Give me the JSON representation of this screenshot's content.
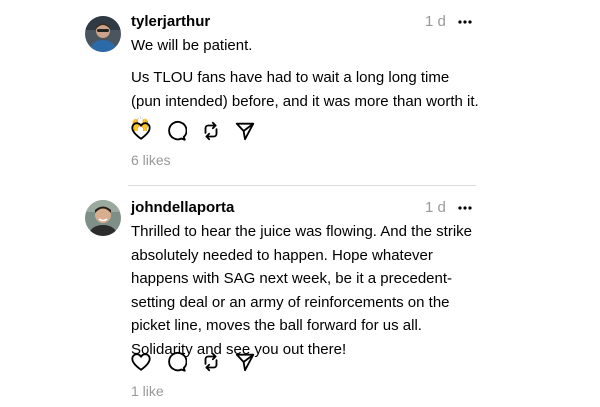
{
  "posts": [
    {
      "username": "tylerjarthur",
      "timestamp": "1 d",
      "avatar_icon": "user-avatar",
      "more_icon": "ellipsis-icon",
      "text_para1": "We will be patient.",
      "text_para2": "Us TLOU fans have had to wait a long long time (pun intended) before, and it was more than worth it. 🙌",
      "likes": "6 likes"
    },
    {
      "username": "johndellaporta",
      "timestamp": "1 d",
      "avatar_icon": "user-avatar",
      "more_icon": "ellipsis-icon",
      "text_para1": "Thrilled to hear the juice was flowing. And the strike absolutely needed to happen. Hope whatever happens with SAG next week, be it a precedent-setting deal or an army of reinforcements on the picket line, moves the ball forward for us all. Solidarity and see you out there!",
      "likes": "1 like"
    }
  ],
  "action_icons": [
    "heart-icon",
    "comment-icon",
    "repost-icon",
    "share-icon"
  ],
  "colors": {
    "text": "#000000",
    "muted": "#999999",
    "divider": "#dbdbdb",
    "background": "#ffffff"
  }
}
